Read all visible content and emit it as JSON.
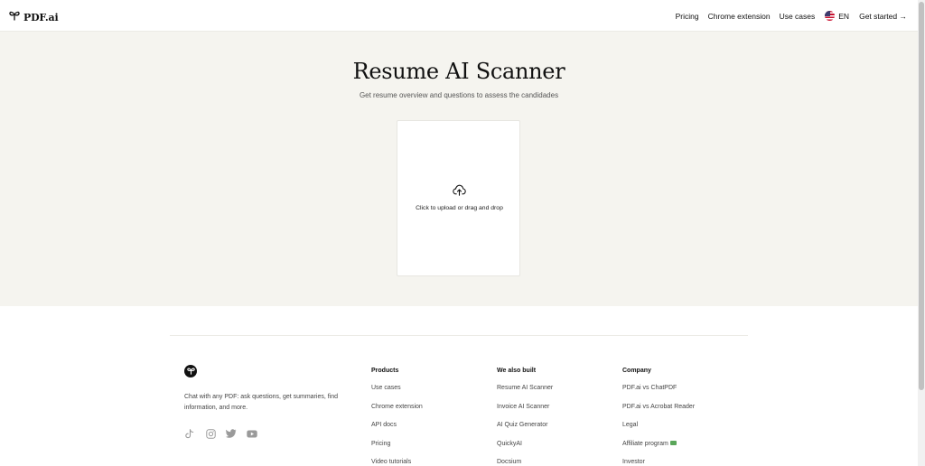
{
  "header": {
    "logo_text": "PDF.ai",
    "nav": [
      "Pricing",
      "Chrome extension",
      "Use cases"
    ],
    "lang": "EN",
    "cta": "Get started →"
  },
  "hero": {
    "title": "Resume AI Scanner",
    "subtitle": "Get resume overview and questions to assess the candidades",
    "upload_text": "Click to upload or drag and drop"
  },
  "footer": {
    "description": "Chat with any PDF: ask questions, get summaries, find information, and more.",
    "socials": [
      "tiktok-icon",
      "instagram-icon",
      "twitter-icon",
      "youtube-icon"
    ],
    "columns": [
      {
        "heading": "Products",
        "links": [
          "Use cases",
          "Chrome extension",
          "API docs",
          "Pricing",
          "Video tutorials"
        ]
      },
      {
        "heading": "We also built",
        "links": [
          "Resume AI Scanner",
          "Invoice AI Scanner",
          "AI Quiz Generator",
          "QuickyAI",
          "Docsium"
        ]
      },
      {
        "heading": "Company",
        "links": [
          "PDF.ai vs ChatPDF",
          "PDF.ai vs Acrobat Reader",
          "Legal",
          "Affiliate program",
          "Investor"
        ]
      }
    ]
  },
  "colors": {
    "hero_bg": "#f5f4ef",
    "text": "#111111",
    "muted": "#444444"
  }
}
